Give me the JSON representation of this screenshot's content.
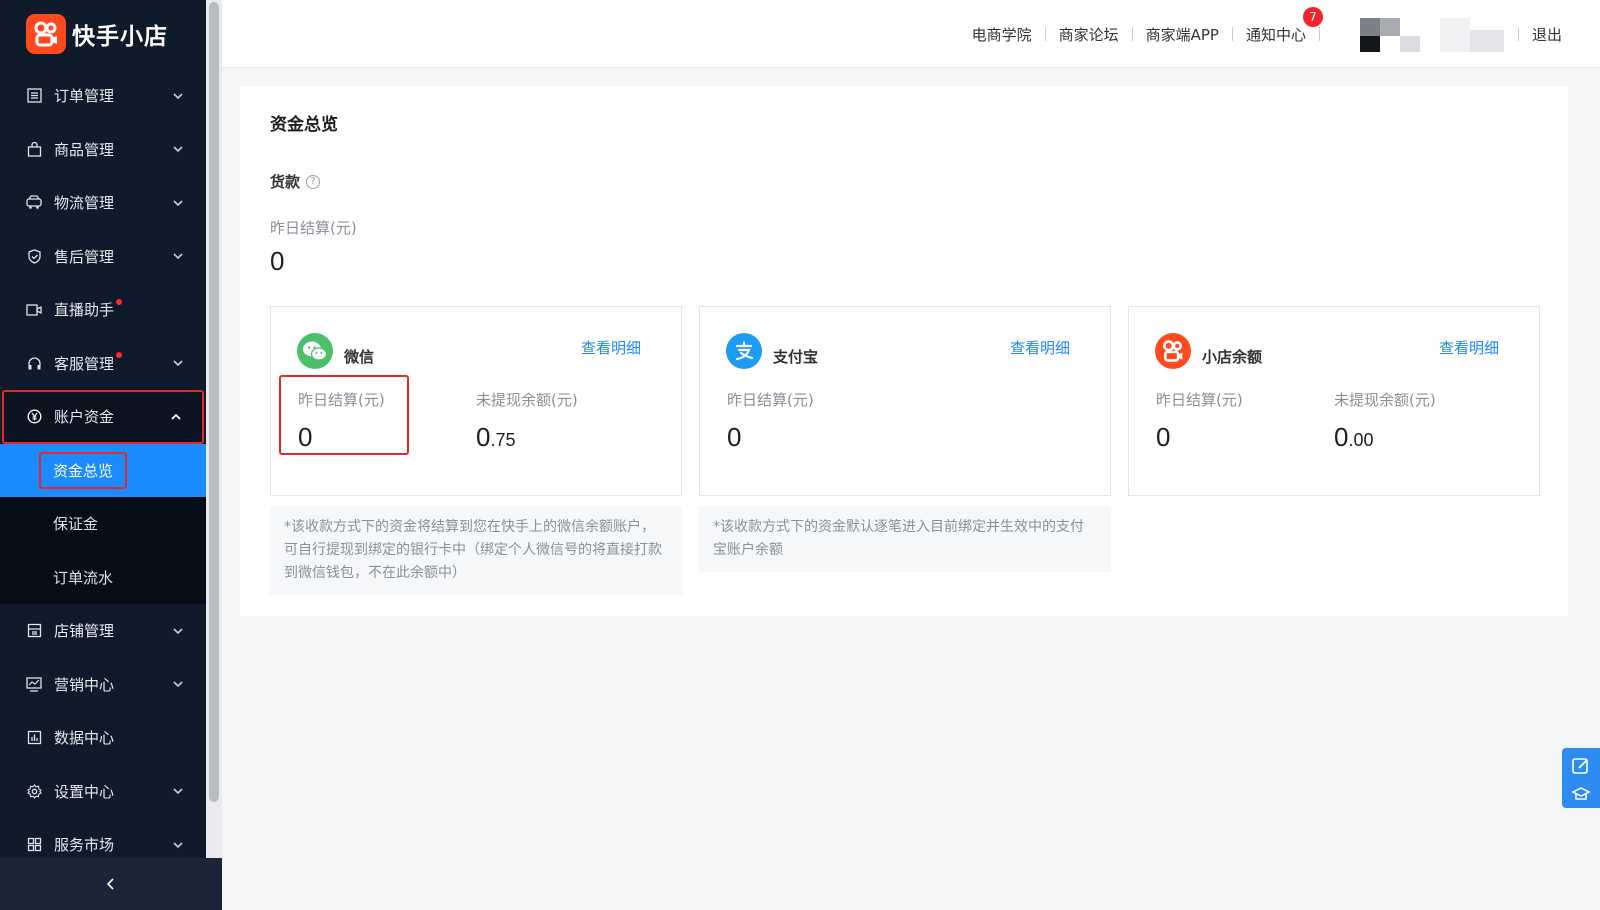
{
  "app": {
    "logo_text": "快手小店"
  },
  "sidebar": {
    "items": [
      {
        "label": "订单管理",
        "icon": "list-icon",
        "chevron": true
      },
      {
        "label": "商品管理",
        "icon": "bag-icon",
        "chevron": true
      },
      {
        "label": "物流管理",
        "icon": "truck-icon",
        "chevron": true
      },
      {
        "label": "售后管理",
        "icon": "shield-icon",
        "chevron": true
      },
      {
        "label": "直播助手",
        "icon": "video-icon",
        "dot": true
      },
      {
        "label": "客服管理",
        "icon": "headset-icon",
        "chevron": true,
        "dot": true
      },
      {
        "label": "账户资金",
        "icon": "yen-icon",
        "open": true
      },
      {
        "label": "店铺管理",
        "icon": "store-icon",
        "chevron": true
      },
      {
        "label": "营销中心",
        "icon": "chart-icon",
        "chevron": true
      },
      {
        "label": "数据中心",
        "icon": "bar-chart-icon"
      },
      {
        "label": "设置中心",
        "icon": "gear-icon",
        "chevron": true
      },
      {
        "label": "服务市场",
        "icon": "grid-icon",
        "chevron": true
      }
    ],
    "subitems": [
      "资金总览",
      "保证金",
      "订单流水"
    ]
  },
  "header": {
    "links": [
      "电商学院",
      "商家论坛",
      "商家端APP",
      "通知中心"
    ],
    "notification_badge": "7",
    "logout": "退出"
  },
  "main": {
    "title": "资金总览",
    "section": "货款",
    "help": "?",
    "yesterday_label": "昨日结算(元)",
    "yesterday_value": "0",
    "cards": [
      {
        "name": "微信",
        "detail": "查看明细",
        "icon": "wechat-icon",
        "col1_label": "昨日结算(元)",
        "col1_value": "0",
        "col2_label": "未提现余额(元)",
        "col2_value_int": "0",
        "col2_value_dec": ".75",
        "note": "*该收款方式下的资金将结算到您在快手上的微信余额账户，可自行提现到绑定的银行卡中（绑定个人微信号的将直接打款到微信钱包，不在此余额中）"
      },
      {
        "name": "支付宝",
        "detail": "查看明细",
        "icon": "alipay-icon",
        "col1_label": "昨日结算(元)",
        "col1_value": "0",
        "note": "*该收款方式下的资金默认逐笔进入目前绑定并生效中的支付宝账户余额"
      },
      {
        "name": "小店余额",
        "detail": "查看明细",
        "icon": "kwai-shop-icon",
        "col1_label": "昨日结算(元)",
        "col1_value": "0",
        "col2_label": "未提现余额(元)",
        "col2_value_int": "0",
        "col2_value_dec": ".00"
      }
    ]
  },
  "colors": {
    "accent": "#1c8bff",
    "sidebar": "#0f1a2a",
    "highlight": "#e5282a",
    "brand": "#fe4a1e"
  }
}
